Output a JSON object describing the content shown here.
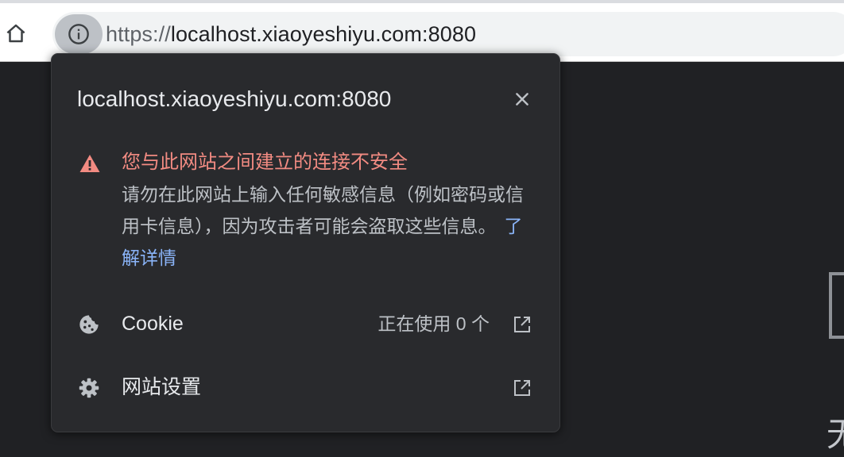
{
  "toolbar": {
    "url_scheme": "https://",
    "url_host": "localhost.xiaoyeshiyu.com:8080",
    "home_icon": "home-icon",
    "info_icon": "info-icon"
  },
  "popup": {
    "host": "localhost.xiaoyeshiyu.com:8080",
    "warning_title": "您与此网站之间建立的连接不安全",
    "warning_desc": "请勿在此网站上输入任何敏感信息（例如密码或信用卡信息），因为攻击者可能会盗取这些信息。",
    "learn_more": "了解详情",
    "cookie_label": "Cookie",
    "cookie_status": "正在使用 0 个",
    "site_settings_label": "网站设置"
  },
  "background": {
    "partial_char": "无"
  },
  "colors": {
    "warning": "#f28b82",
    "link": "#8ab4f8",
    "popup_bg": "#292a2d",
    "page_bg": "#202124"
  }
}
